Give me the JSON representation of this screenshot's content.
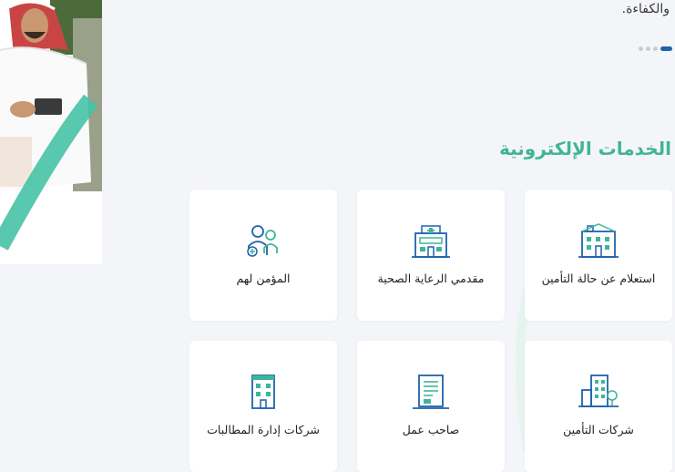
{
  "hero": {
    "text_fragment": "والكفاءة.",
    "carousel": {
      "slide_count": 4,
      "active_index": 0
    }
  },
  "services": {
    "title": "الخدمات الإلكترونية",
    "cards": [
      {
        "label": "استعلام عن حالة التأمين",
        "icon": "hospital-building-icon"
      },
      {
        "label": "مقدمي الرعاية الصحية",
        "icon": "medical-center-icon"
      },
      {
        "label": "المؤمن لهم",
        "icon": "insured-people-icon"
      },
      {
        "label": "شركات التأمين",
        "icon": "insurance-companies-icon"
      },
      {
        "label": "صاحب عمل",
        "icon": "employer-document-icon"
      },
      {
        "label": "شركات إدارة المطالبات",
        "icon": "claims-management-icon"
      }
    ]
  },
  "colors": {
    "accent_green": "#3fb59a",
    "brand_blue": "#1f63ad",
    "background": "#f4f5f8"
  }
}
